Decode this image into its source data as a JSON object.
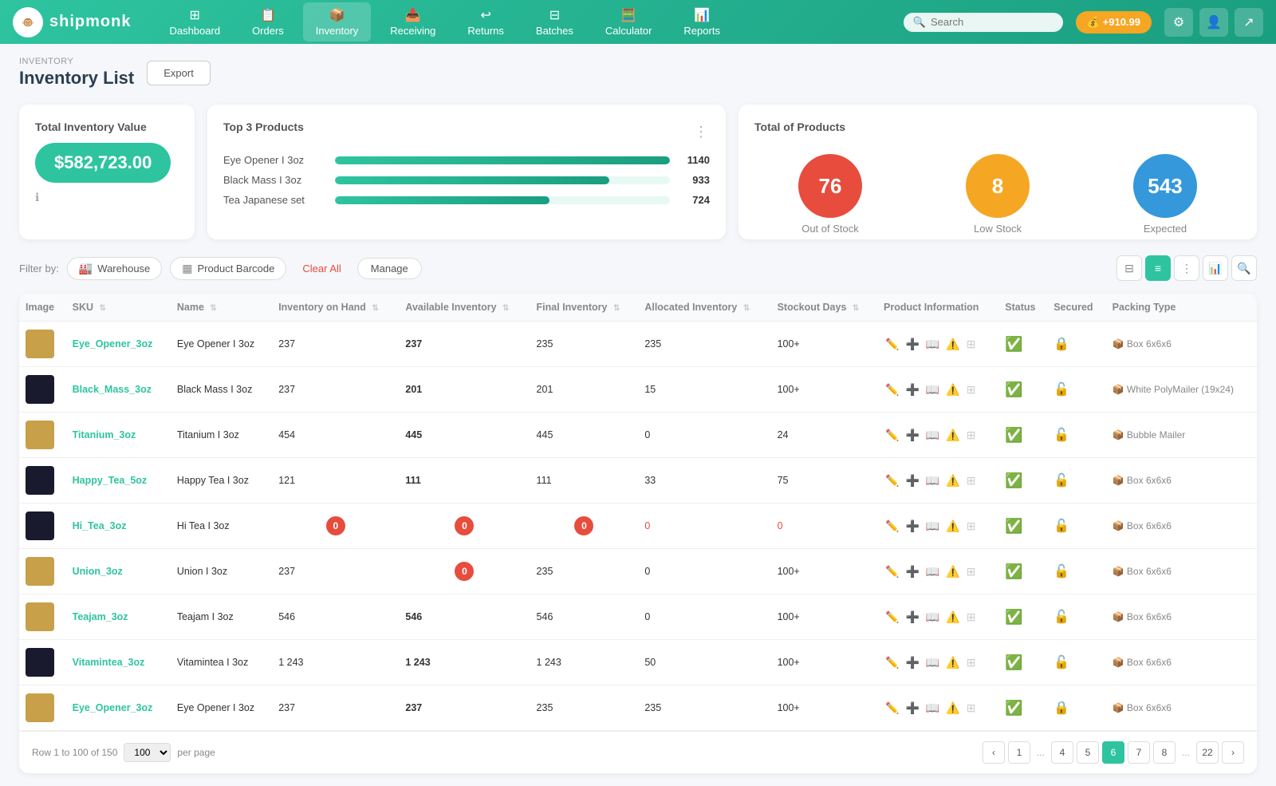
{
  "nav": {
    "logo_text": "shipmonk",
    "items": [
      {
        "label": "Dashboard",
        "icon": "⊞",
        "active": false
      },
      {
        "label": "Orders",
        "icon": "📋",
        "active": false
      },
      {
        "label": "Inventory",
        "icon": "📦",
        "active": true
      },
      {
        "label": "Receiving",
        "icon": "📥",
        "active": false
      },
      {
        "label": "Returns",
        "icon": "↩",
        "active": false
      },
      {
        "label": "Batches",
        "icon": "⊟",
        "active": false
      },
      {
        "label": "Calculator",
        "icon": "🧮",
        "active": false
      },
      {
        "label": "Reports",
        "icon": "📊",
        "active": false
      }
    ],
    "search_placeholder": "Search",
    "balance": "+910.99"
  },
  "page": {
    "breadcrumb": "INVENTORY",
    "title": "Inventory List",
    "export_label": "Export"
  },
  "inventory_value": {
    "title": "Total Inventory Value",
    "value": "$582,723.00"
  },
  "top3": {
    "title": "Top 3 Products",
    "products": [
      {
        "name": "Eye Opener I 3oz",
        "value": 1140,
        "pct": 100
      },
      {
        "name": "Black Mass I 3oz",
        "value": 933,
        "pct": 82
      },
      {
        "name": "Tea Japanese set",
        "value": 724,
        "pct": 64
      }
    ]
  },
  "totals": {
    "title": "Total of Products",
    "items": [
      {
        "value": 76,
        "label": "Out of Stock",
        "color": "red"
      },
      {
        "value": 8,
        "label": "Low Stock",
        "color": "orange"
      },
      {
        "value": 543,
        "label": "Expected",
        "color": "blue"
      }
    ]
  },
  "filters": {
    "label": "Filter by:",
    "warehouse_label": "Warehouse",
    "barcode_label": "Product Barcode",
    "clear_label": "Clear All",
    "manage_label": "Manage"
  },
  "table": {
    "columns": [
      "Image",
      "SKU",
      "Name",
      "Inventory on Hand",
      "Available Inventory",
      "Final Inventory",
      "Allocated Inventory",
      "Stockout Days",
      "Product Information",
      "Status",
      "Secured",
      "Packing Type"
    ],
    "rows": [
      {
        "image": "gold",
        "sku": "Eye_Opener_3oz",
        "name": "Eye Opener I 3oz",
        "ioh": 237,
        "avail": 237,
        "final": 235,
        "alloc": 235,
        "stockout": "100+",
        "status": "ok",
        "secured": true,
        "packing": "Box 6x6x6",
        "avail_zero": false,
        "final_zero": false
      },
      {
        "image": "dark",
        "sku": "Black_Mass_3oz",
        "name": "Black Mass I 3oz",
        "ioh": 237,
        "avail": 201,
        "final": 201,
        "alloc": 15,
        "stockout": "100+",
        "status": "ok",
        "secured": false,
        "packing": "White PolyMailer (19x24)",
        "avail_zero": false,
        "final_zero": false
      },
      {
        "image": "gold",
        "sku": "Titanium_3oz",
        "name": "Titanium I 3oz",
        "ioh": 454,
        "avail": 445,
        "final": 445,
        "alloc": 0,
        "stockout": 24,
        "status": "ok",
        "secured": false,
        "packing": "Bubble Mailer",
        "avail_zero": false,
        "final_zero": false
      },
      {
        "image": "dark",
        "sku": "Happy_Tea_5oz",
        "name": "Happy Tea I 3oz",
        "ioh": 121,
        "avail": 111,
        "final": 111,
        "alloc": 33,
        "stockout": 75,
        "status": "ok",
        "secured": false,
        "packing": "Box 6x6x6",
        "avail_zero": false,
        "final_zero": false
      },
      {
        "image": "dark",
        "sku": "Hi_Tea_3oz",
        "name": "Hi Tea I 3oz",
        "ioh": 0,
        "avail": 0,
        "final": 0,
        "alloc": 0,
        "stockout": 0,
        "status": "ok",
        "secured": false,
        "packing": "Box 6x6x6",
        "avail_zero": true,
        "final_zero": true
      },
      {
        "image": "gold",
        "sku": "Union_3oz",
        "name": "Union I 3oz",
        "ioh": 237,
        "avail": 0,
        "final": 235,
        "alloc": 0,
        "stockout": "100+",
        "status": "ok",
        "secured": false,
        "packing": "Box 6x6x6",
        "avail_zero": true,
        "final_zero": false
      },
      {
        "image": "gold",
        "sku": "Teajam_3oz",
        "name": "Teajam I 3oz",
        "ioh": 546,
        "avail": 546,
        "final": 546,
        "alloc": 0,
        "stockout": "100+",
        "status": "ok",
        "secured": false,
        "packing": "Box 6x6x6",
        "avail_zero": false,
        "final_zero": false
      },
      {
        "image": "dark",
        "sku": "Vitamintea_3oz",
        "name": "Vitamintea I 3oz",
        "ioh": "1 243",
        "avail": "1 243",
        "final": "1 243",
        "alloc": 50,
        "stockout": "100+",
        "status": "ok",
        "secured": false,
        "packing": "Box 6x6x6",
        "avail_zero": false,
        "final_zero": false
      },
      {
        "image": "gold",
        "sku": "Eye_Opener_3oz",
        "name": "Eye Opener I 3oz",
        "ioh": 237,
        "avail": 237,
        "final": 235,
        "alloc": 235,
        "stockout": "100+",
        "status": "ok",
        "secured": true,
        "packing": "Box 6x6x6",
        "avail_zero": false,
        "final_zero": false
      }
    ]
  },
  "pagination": {
    "info": "Row 1 to 100 of 150",
    "per_page": "100",
    "pages": [
      1,
      4,
      5,
      6,
      7,
      8,
      22
    ],
    "active_page": 6,
    "ellipsis_after": [
      1,
      8
    ]
  }
}
